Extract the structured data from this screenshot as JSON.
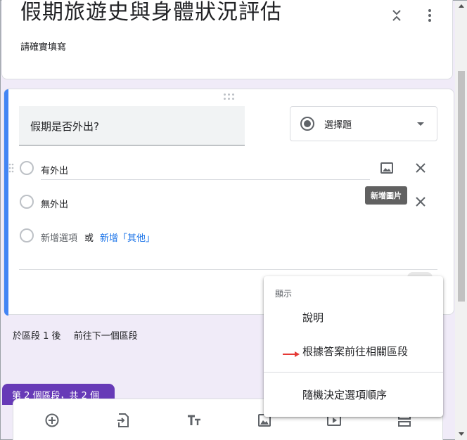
{
  "form": {
    "title": "假期旅遊史與身體狀況評估",
    "description": "請確實填寫"
  },
  "question": {
    "title": "假期是否外出?",
    "type_label": "選擇題",
    "options": [
      "有外出",
      "無外出"
    ],
    "add_option": "新增選項",
    "or": "或",
    "add_other": "新增「其他」"
  },
  "tooltip": {
    "add_image": "新增圖片"
  },
  "section": {
    "after_label": "於區段 1 後",
    "next_action": "前往下一個區段",
    "badge": "第 2 個區段，共 2 個"
  },
  "menu": {
    "header": "顯示",
    "items": [
      "說明",
      "根據答案前往相關區段",
      "隨機決定選項順序"
    ]
  },
  "colors": {
    "accent_blue": "#4285f4",
    "link_blue": "#1a73e8",
    "section_purple": "#673ab7",
    "arrow_red": "#e53935",
    "background": "#f0ebf8"
  },
  "icons": {
    "collapse": "unfold-less-icon",
    "more": "more-vert-icon",
    "image": "image-icon",
    "close": "close-icon",
    "drag": "drag-indicator-icon",
    "toolbar": [
      "add-circle-icon",
      "import-icon",
      "title-icon",
      "image-icon",
      "video-icon",
      "section-icon"
    ]
  }
}
